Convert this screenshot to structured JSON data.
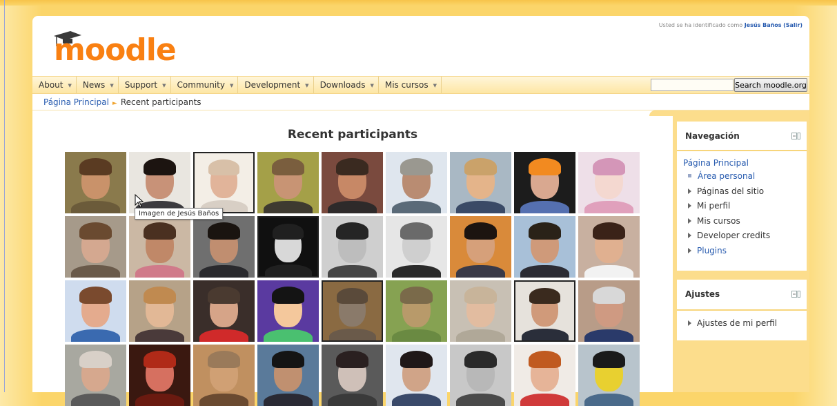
{
  "login": {
    "prefix": "Usted se ha identificado como",
    "user": "Jesús Baños",
    "logout": "(Salir)"
  },
  "logo": {
    "text": "moodle"
  },
  "menu": [
    {
      "label": "About"
    },
    {
      "label": "News"
    },
    {
      "label": "Support"
    },
    {
      "label": "Community"
    },
    {
      "label": "Development"
    },
    {
      "label": "Downloads"
    },
    {
      "label": "Mis cursos"
    }
  ],
  "search": {
    "button_label": "Search moodle.org",
    "value": ""
  },
  "breadcrumb": {
    "home": "Página Principal",
    "current": "Recent participants"
  },
  "page_title": "Recent participants",
  "tooltip": "Imagen de Jesús Baños",
  "participants": [
    {
      "bg": "#8a7a4c",
      "skin": "#c9926a",
      "hair": "#5a3b22",
      "cloth": "#6b5b3a"
    },
    {
      "bg": "#e9e6e0",
      "skin": "#c89278",
      "hair": "#1c1410",
      "cloth": "#3c3b3f"
    },
    {
      "bg": "#f3eee6",
      "skin": "#e1b49a",
      "hair": "#d8c0a8",
      "cloth": "#d8cfc5"
    },
    {
      "bg": "#a4a048",
      "skin": "#c89474",
      "hair": "#7a5e3e",
      "cloth": "#3e3a30"
    },
    {
      "bg": "#7a4a3e",
      "skin": "#c78866",
      "hair": "#3a2a20",
      "cloth": "#2e2a2a"
    },
    {
      "bg": "#dfe6ee",
      "skin": "#b98c72",
      "hair": "#9a9890",
      "cloth": "#5a6a78"
    },
    {
      "bg": "#a9b8c4",
      "skin": "#e4b48a",
      "hair": "#caa26a",
      "cloth": "#3a4a66"
    },
    {
      "bg": "#1c1c1c",
      "skin": "#d9a890",
      "hair": "#f28a20",
      "cloth": "#5570b0"
    },
    {
      "bg": "#eedfe8",
      "skin": "#f4d8d0",
      "hair": "#d496b8",
      "cloth": "#e0a0bc"
    },
    {
      "bg": "#a69a8a",
      "skin": "#d4a890",
      "hair": "#6a4a30",
      "cloth": "#6a5a4a"
    },
    {
      "bg": "#cbb8a4",
      "skin": "#c08868",
      "hair": "#4a3020",
      "cloth": "#d07a8a"
    },
    {
      "bg": "#6f6f6f",
      "skin": "#c08e70",
      "hair": "#1a1410",
      "cloth": "#2a2a2e"
    },
    {
      "bg": "#101010",
      "skin": "#d8d8d8",
      "hair": "#202020",
      "cloth": "#202020"
    },
    {
      "bg": "#cfcfcf",
      "skin": "#bdbdbd",
      "hair": "#252525",
      "cloth": "#454545"
    },
    {
      "bg": "#e6e6e6",
      "skin": "#cfcfcf",
      "hair": "#6a6a6a",
      "cloth": "#2a2a2a"
    },
    {
      "bg": "#d98a3a",
      "skin": "#d6a07a",
      "hair": "#1c1410",
      "cloth": "#3a3a48"
    },
    {
      "bg": "#a8c0d8",
      "skin": "#cf9a7a",
      "hair": "#2a2218",
      "cloth": "#2c2c34"
    },
    {
      "bg": "#c8b0a0",
      "skin": "#e0b090",
      "hair": "#3a2218",
      "cloth": "#f2f2f2"
    },
    {
      "bg": "#cfdcee",
      "skin": "#e4ab8e",
      "hair": "#7a4a2e",
      "cloth": "#3a6ab0"
    },
    {
      "bg": "#b6a288",
      "skin": "#e2b896",
      "hair": "#c08a50",
      "cloth": "#4a3a3a"
    },
    {
      "bg": "#3a2e2a",
      "skin": "#d6a488",
      "hair": "#4a3a30",
      "cloth": "#d02a2a"
    },
    {
      "bg": "#5a3aa0",
      "skin": "#f4c89c",
      "hair": "#141414",
      "cloth": "#4ac070"
    },
    {
      "bg": "#8a6a42",
      "skin": "#8a7a6a",
      "hair": "#5a4a3a",
      "cloth": "#6a5a4a"
    },
    {
      "bg": "#86a252",
      "skin": "#b89a6a",
      "hair": "#7a6a4a",
      "cloth": "#6a8a42"
    },
    {
      "bg": "#c8c0b4",
      "skin": "#e2bca0",
      "hair": "#c8b49a",
      "cloth": "#b0a898"
    },
    {
      "bg": "#e6e2dc",
      "skin": "#d09a7a",
      "hair": "#3a2a1e",
      "cloth": "#2a2e3a"
    },
    {
      "bg": "#b89c88",
      "skin": "#cf9a82",
      "hair": "#d8d8d8",
      "cloth": "#2a3a6a"
    },
    {
      "bg": "#a8a8a0",
      "skin": "#d6a88e",
      "hair": "#d8d0c8",
      "cloth": "#5a5a5a"
    },
    {
      "bg": "#3a1810",
      "skin": "#d67060",
      "hair": "#b02a18",
      "cloth": "#6a1a10"
    },
    {
      "bg": "#c09060",
      "skin": "#d0a074",
      "hair": "#9a7a5a",
      "cloth": "#6a4a30"
    },
    {
      "bg": "#5a7a9a",
      "skin": "#c09070",
      "hair": "#141414",
      "cloth": "#2a2a34"
    },
    {
      "bg": "#5a5a5a",
      "skin": "#cfc0b8",
      "hair": "#2a2020",
      "cloth": "#3a3a3a"
    },
    {
      "bg": "#e0e6ee",
      "skin": "#d0a488",
      "hair": "#201818",
      "cloth": "#3a4a6a"
    },
    {
      "bg": "#c8c8c8",
      "skin": "#b8b8b8",
      "hair": "#2a2a2a",
      "cloth": "#4a4a4a"
    },
    {
      "bg": "#f0ebe6",
      "skin": "#e6b498",
      "hair": "#c05a20",
      "cloth": "#d03a3a"
    },
    {
      "bg": "#b8c4cc",
      "skin": "#e8d030",
      "hair": "#1a1a1a",
      "cloth": "#4a6a8a"
    }
  ],
  "navigation": {
    "title": "Navegación",
    "root": "Página Principal",
    "items": [
      {
        "label": "Área personal",
        "kind": "leaf",
        "link": true
      },
      {
        "label": "Páginas del sitio",
        "kind": "branch",
        "link": false
      },
      {
        "label": "Mi perfil",
        "kind": "branch",
        "link": false
      },
      {
        "label": "Mis cursos",
        "kind": "branch",
        "link": false
      },
      {
        "label": "Developer credits",
        "kind": "branch",
        "link": false
      },
      {
        "label": "Plugins",
        "kind": "branch",
        "link": true
      }
    ]
  },
  "settings": {
    "title": "Ajustes",
    "items": [
      {
        "label": "Ajustes de mi perfil"
      }
    ]
  }
}
